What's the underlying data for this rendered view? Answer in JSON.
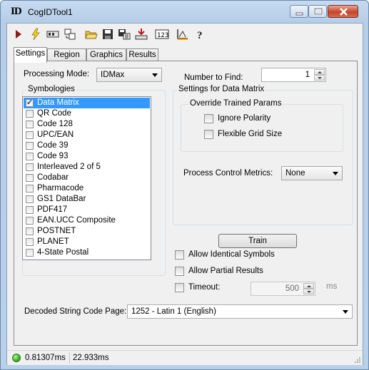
{
  "window": {
    "title": "CogIDTool1",
    "logo": "ID"
  },
  "toolbar": {
    "icons": [
      "run-icon",
      "trigger-icon",
      "setup-icon",
      "layout-icon",
      "open-icon",
      "save-icon",
      "save-settings-icon",
      "import-icon",
      "counter-icon",
      "measure-icon",
      "help-icon"
    ]
  },
  "tabs": [
    {
      "label": "Settings",
      "active": true
    },
    {
      "label": "Region",
      "active": false
    },
    {
      "label": "Graphics",
      "active": false
    },
    {
      "label": "Results",
      "active": false
    }
  ],
  "settings": {
    "processing_mode_label": "Processing Mode:",
    "processing_mode_value": "IDMax",
    "number_to_find_label": "Number to Find:",
    "number_to_find_value": "1",
    "symbologies_title": "Symbologies",
    "symbologies": [
      {
        "label": "Data Matrix",
        "checked": true,
        "selected": true
      },
      {
        "label": "QR Code",
        "checked": false,
        "selected": false
      },
      {
        "label": "Code 128",
        "checked": false,
        "selected": false
      },
      {
        "label": "UPC/EAN",
        "checked": false,
        "selected": false
      },
      {
        "label": "Code 39",
        "checked": false,
        "selected": false
      },
      {
        "label": "Code 93",
        "checked": false,
        "selected": false
      },
      {
        "label": "Interleaved 2 of 5",
        "checked": false,
        "selected": false
      },
      {
        "label": "Codabar",
        "checked": false,
        "selected": false
      },
      {
        "label": "Pharmacode",
        "checked": false,
        "selected": false
      },
      {
        "label": "GS1 DataBar",
        "checked": false,
        "selected": false
      },
      {
        "label": "PDF417",
        "checked": false,
        "selected": false
      },
      {
        "label": "EAN.UCC Composite",
        "checked": false,
        "selected": false
      },
      {
        "label": "POSTNET",
        "checked": false,
        "selected": false
      },
      {
        "label": "PLANET",
        "checked": false,
        "selected": false
      },
      {
        "label": "4-State Postal",
        "checked": false,
        "selected": false
      }
    ],
    "dm_settings_title": "Settings for Data Matrix",
    "override_title": "Override Trained Params",
    "ignore_polarity_label": "Ignore Polarity",
    "flexible_grid_label": "Flexible Grid Size",
    "process_metrics_label": "Process Control Metrics:",
    "process_metrics_value": "None",
    "train_label": "Train",
    "allow_identical_label": "Allow Identical Symbols",
    "allow_partial_label": "Allow Partial Results",
    "timeout_label": "Timeout:",
    "timeout_value": "500",
    "timeout_unit": "ms",
    "code_page_label": "Decoded String Code Page:",
    "code_page_value": "1252 - Latin 1 (English)"
  },
  "status": {
    "time1": "0.81307ms",
    "time2": "22.933ms",
    "colors": {
      "ok": "#2fa11b"
    }
  }
}
